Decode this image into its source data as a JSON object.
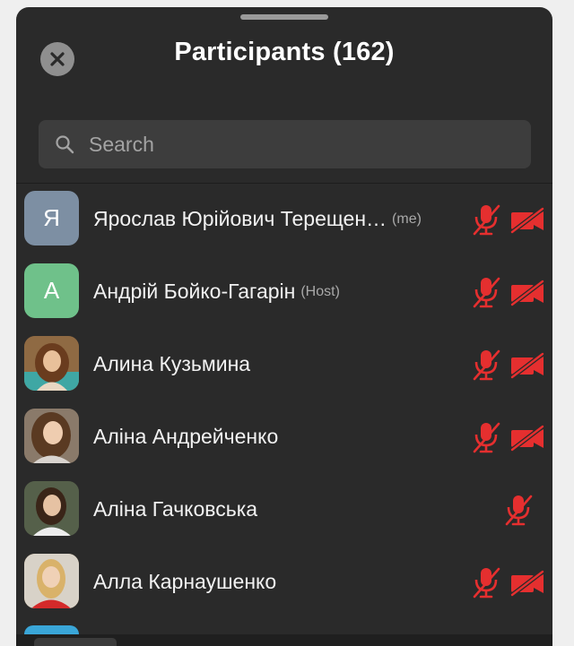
{
  "header": {
    "title": "Participants (162)",
    "close_icon": "close-icon"
  },
  "search": {
    "placeholder": "Search",
    "value": "",
    "icon": "search-icon"
  },
  "colors": {
    "muted_red": "#e52f2f",
    "sheet_bg": "#2a2a2a",
    "search_bg": "#3d3d3d"
  },
  "participants": [
    {
      "name": "Ярослав Юрійович Терещен…",
      "tag": "(me)",
      "avatar_initial": "Я",
      "avatar_color": "#7d8fa3",
      "mic_muted": true,
      "video_off": true
    },
    {
      "name": "Андрій Бойко-Гагарін",
      "tag": "(Host)",
      "avatar_initial": "А",
      "avatar_color": "#6fc18a",
      "mic_muted": true,
      "video_off": true
    },
    {
      "name": "Алина Кузьмина",
      "tag": "",
      "avatar_initial": "",
      "avatar_color": "#7a5230",
      "mic_muted": true,
      "video_off": true
    },
    {
      "name": "Аліна Андрейченко",
      "tag": "",
      "avatar_initial": "",
      "avatar_color": "#6b5545",
      "mic_muted": true,
      "video_off": true
    },
    {
      "name": "Аліна Гачковська",
      "tag": "",
      "avatar_initial": "",
      "avatar_color": "#4a4f3d",
      "mic_muted": true,
      "video_off": false
    },
    {
      "name": "Алла Карнаушенко",
      "tag": "",
      "avatar_initial": "",
      "avatar_color": "#c9a36a",
      "mic_muted": true,
      "video_off": true
    }
  ]
}
